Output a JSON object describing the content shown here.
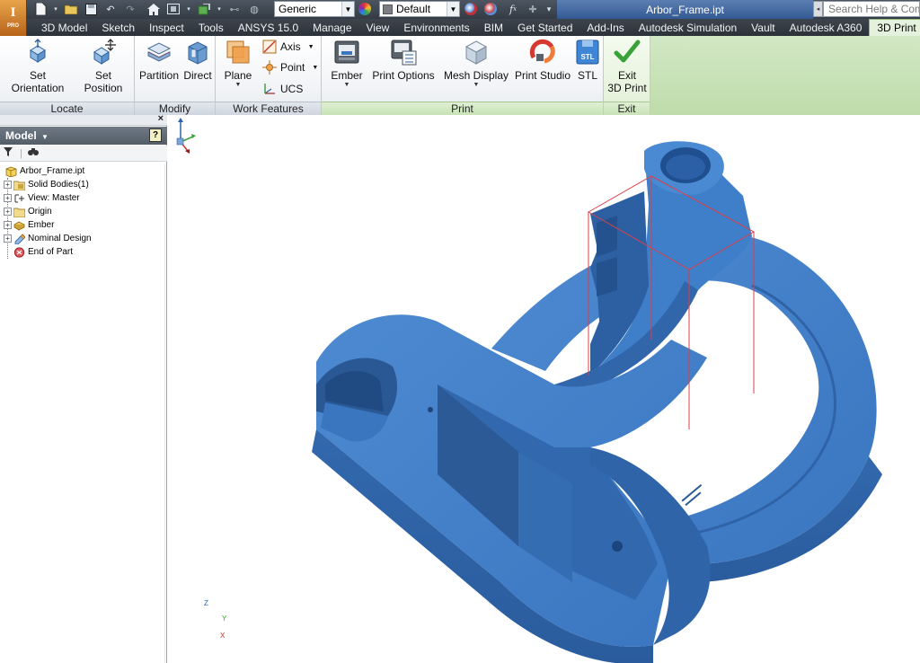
{
  "app": {
    "logo_text": "I",
    "logo_badge": "PRO",
    "document_title": "Arbor_Frame.ipt"
  },
  "quick_access": {
    "material_value": "Generic",
    "appearance_value": "Default",
    "search_placeholder": "Search Help & Com"
  },
  "tabs": [
    {
      "label": "3D Model"
    },
    {
      "label": "Sketch"
    },
    {
      "label": "Inspect"
    },
    {
      "label": "Tools"
    },
    {
      "label": "ANSYS 15.0"
    },
    {
      "label": "Manage"
    },
    {
      "label": "View"
    },
    {
      "label": "Environments"
    },
    {
      "label": "BIM"
    },
    {
      "label": "Get Started"
    },
    {
      "label": "Add-Ins"
    },
    {
      "label": "Autodesk Simulation"
    },
    {
      "label": "Vault"
    },
    {
      "label": "Autodesk A360"
    },
    {
      "label": "3D Print"
    }
  ],
  "ribbon": {
    "locate": {
      "title": "Locate",
      "set_orientation": "Set Orientation",
      "set_position": "Set Position"
    },
    "modify": {
      "title": "Modify",
      "partition": "Partition",
      "direct": "Direct"
    },
    "work_features": {
      "title": "Work Features",
      "plane": "Plane",
      "axis": "Axis",
      "point": "Point",
      "ucs": "UCS"
    },
    "print": {
      "title": "Print",
      "ember": "Ember",
      "print_options": "Print Options",
      "mesh_display": "Mesh Display",
      "print_studio": "Print Studio",
      "stl": "STL"
    },
    "exit": {
      "title": "Exit",
      "exit_line1": "Exit",
      "exit_line2": "3D Print"
    }
  },
  "browser": {
    "title": "Model",
    "help": "?",
    "close": "×",
    "nodes": [
      {
        "label": "Arbor_Frame.ipt"
      },
      {
        "label": "Solid Bodies(1)"
      },
      {
        "label": "View: Master"
      },
      {
        "label": "Origin"
      },
      {
        "label": "Ember"
      },
      {
        "label": "Nominal Design"
      },
      {
        "label": "End of Part"
      }
    ]
  },
  "triad": {
    "x": "X",
    "y": "Y",
    "z": "Z"
  },
  "colors": {
    "part_blue": "#3a78c2",
    "ribbon_green": "#c8e2b7",
    "print_box_red": "#d9404a"
  }
}
